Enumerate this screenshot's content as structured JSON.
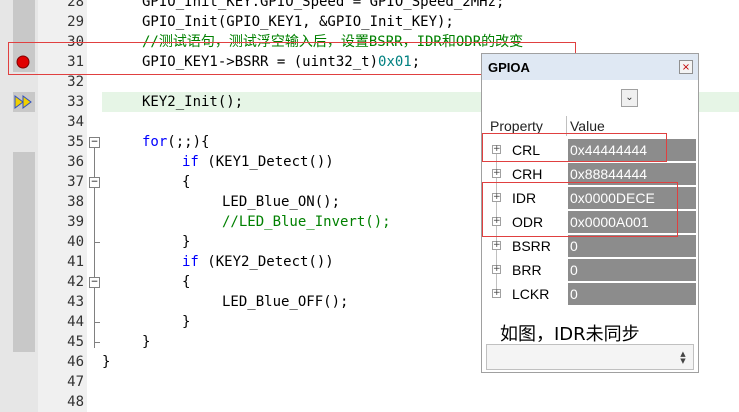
{
  "editor": {
    "line_numbers": [
      "28",
      "29",
      "30",
      "31",
      "32",
      "33",
      "34",
      "35",
      "36",
      "37",
      "38",
      "39",
      "40",
      "41",
      "42",
      "43",
      "44",
      "45",
      "46",
      "47",
      "48"
    ],
    "lines": {
      "l28": "GPIO_Init_KEY.GPIO_Speed = GPIO_Speed_2MHz;",
      "l29": "GPIO_Init(GPIO_KEY1, &GPIO_Init_KEY);",
      "l30": "//测试语句，测试浮空输入后，设置BSRR，IDR和ODR的改变",
      "l31_a": "GPIO_KEY1->BSRR = (uint32_t)",
      "l31_b": "0x01",
      "l31_c": ";",
      "l33": "KEY2_Init();",
      "l35_kw": "for",
      "l35_rest": "(;;){",
      "l36_kw": "if",
      "l36_rest": " (KEY1_Detect())",
      "l37": "{",
      "l38": "LED_Blue_ON();",
      "l39": "//LED_Blue_Invert();",
      "l40": "}",
      "l41_kw": "if",
      "l41_rest": " (KEY2_Detect())",
      "l42": "{",
      "l43": "LED_Blue_OFF();",
      "l44": "}",
      "l45": "}",
      "l46": "}"
    },
    "breakpoint_icon": "red-dot-breakpoint",
    "current_line_icon": "yellow-double-arrow",
    "colors": {
      "keyword": "#0000ff",
      "comment": "#008000",
      "number": "#008080",
      "current_line_bg": "#e6f5e6",
      "annotation_box": "#e04040"
    }
  },
  "panel": {
    "title": "GPIOA",
    "close_icon": "×",
    "dropdown_icon": "⌄",
    "headers": {
      "property": "Property",
      "value": "Value"
    },
    "rows": [
      {
        "name": "CRL",
        "value": "0x44444444"
      },
      {
        "name": "CRH",
        "value": "0x88844444"
      },
      {
        "name": "IDR",
        "value": "0x0000DECE"
      },
      {
        "name": "ODR",
        "value": "0x0000A001"
      },
      {
        "name": "BSRR",
        "value": "0"
      },
      {
        "name": "BRR",
        "value": "0"
      },
      {
        "name": "LCKR",
        "value": "0"
      }
    ],
    "expander_icon": "+",
    "caption": "如图，IDR未同步"
  }
}
